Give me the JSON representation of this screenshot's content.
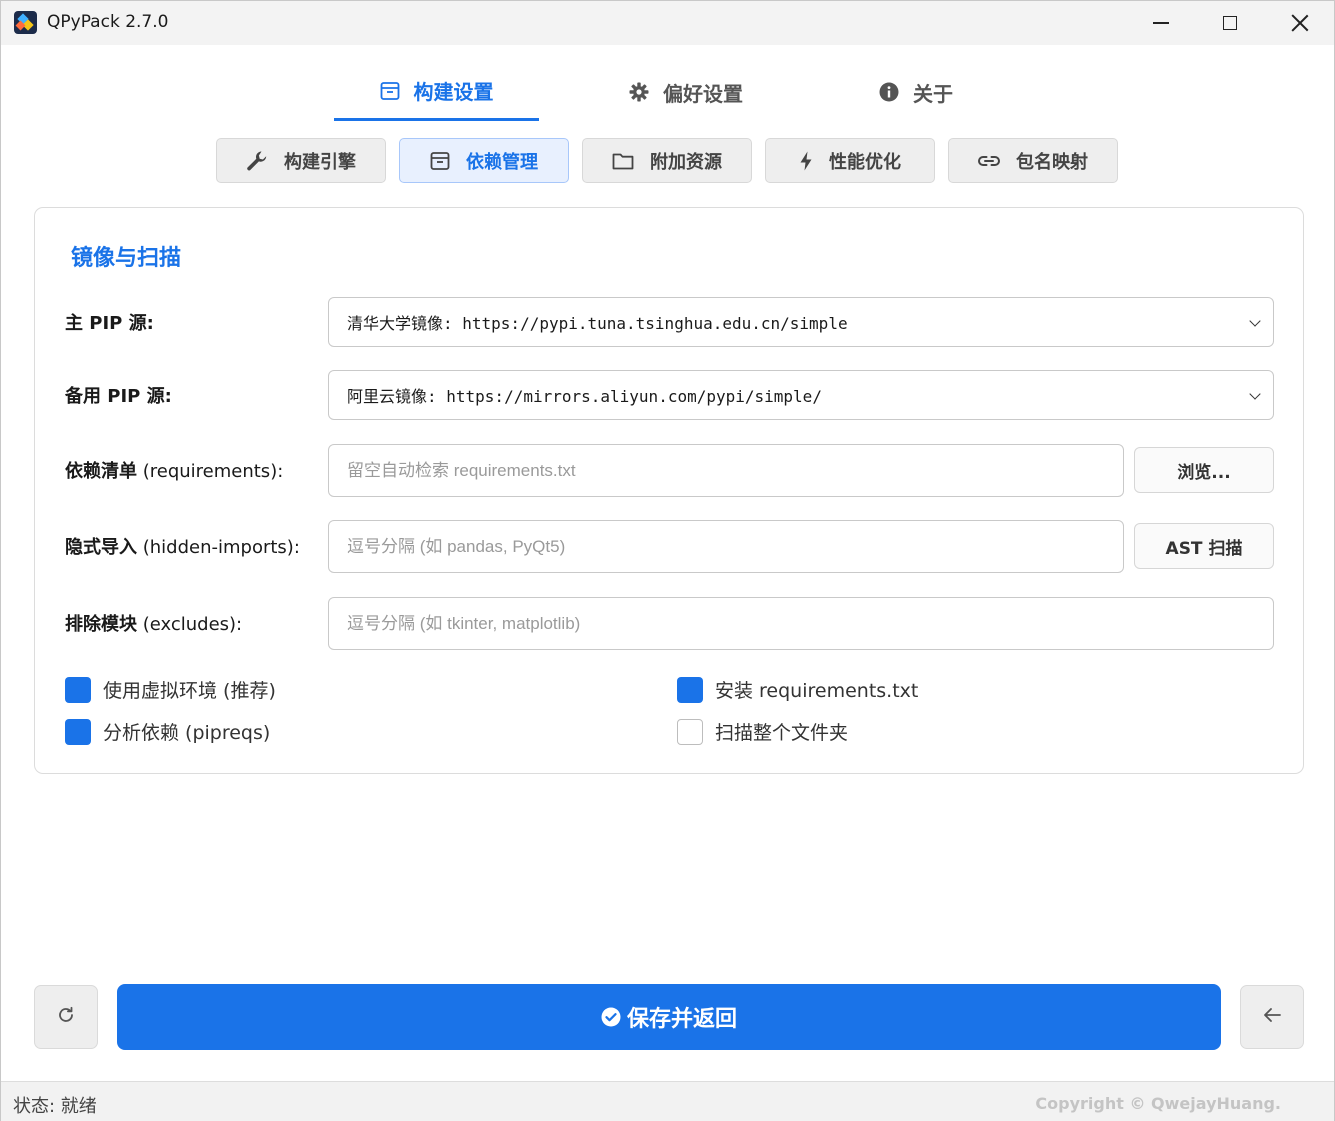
{
  "window": {
    "title": "QPyPack 2.7.0"
  },
  "main_tabs": [
    {
      "label": "构建设置",
      "icon": "archive-icon",
      "active": true
    },
    {
      "label": "偏好设置",
      "icon": "gear-icon",
      "active": false
    },
    {
      "label": "关于",
      "icon": "info-icon",
      "active": false
    }
  ],
  "sub_tabs": [
    {
      "label": "构建引擎",
      "icon": "wrench-icon",
      "active": false
    },
    {
      "label": "依赖管理",
      "icon": "archive-icon",
      "active": true
    },
    {
      "label": "附加资源",
      "icon": "folder-icon",
      "active": false
    },
    {
      "label": "性能优化",
      "icon": "bolt-icon",
      "active": false
    },
    {
      "label": "包名映射",
      "icon": "link-icon",
      "active": false
    }
  ],
  "card": {
    "title": "镜像与扫描",
    "primary_pip": {
      "label_bold": "主 PIP 源:",
      "value": "清华大学镜像: https://pypi.tuna.tsinghua.edu.cn/simple"
    },
    "backup_pip": {
      "label_bold": "备用 PIP 源:",
      "value": "阿里云镜像: https://mirrors.aliyun.com/pypi/simple/"
    },
    "requirements": {
      "label_bold": "依赖清单",
      "label_rest": " (requirements):",
      "placeholder": "留空自动检索 requirements.txt",
      "value": "",
      "button": "浏览..."
    },
    "hidden_imports": {
      "label_bold": "隐式导入",
      "label_rest": " (hidden-imports):",
      "placeholder": "逗号分隔 (如 pandas, PyQt5)",
      "value": "",
      "button": "AST 扫描"
    },
    "excludes": {
      "label_bold": "排除模块",
      "label_rest": " (excludes):",
      "placeholder": "逗号分隔 (如 tkinter, matplotlib)",
      "value": ""
    },
    "checkboxes": [
      {
        "label": "使用虚拟环境 (推荐)",
        "checked": true
      },
      {
        "label": "安装 requirements.txt",
        "checked": true
      },
      {
        "label": "分析依赖 (pipreqs)",
        "checked": true
      },
      {
        "label": "扫描整个文件夹",
        "checked": false
      }
    ]
  },
  "footer": {
    "reset_icon": "refresh-icon",
    "save_label": "保存并返回",
    "save_icon": "check-circle-icon",
    "back_icon": "arrow-left-icon"
  },
  "statusbar": {
    "status": "状态: 就绪",
    "copyright": "Copyright © QwejayHuang."
  },
  "colors": {
    "accent": "#1a73e8",
    "accent_light": "#e8f0fe"
  }
}
